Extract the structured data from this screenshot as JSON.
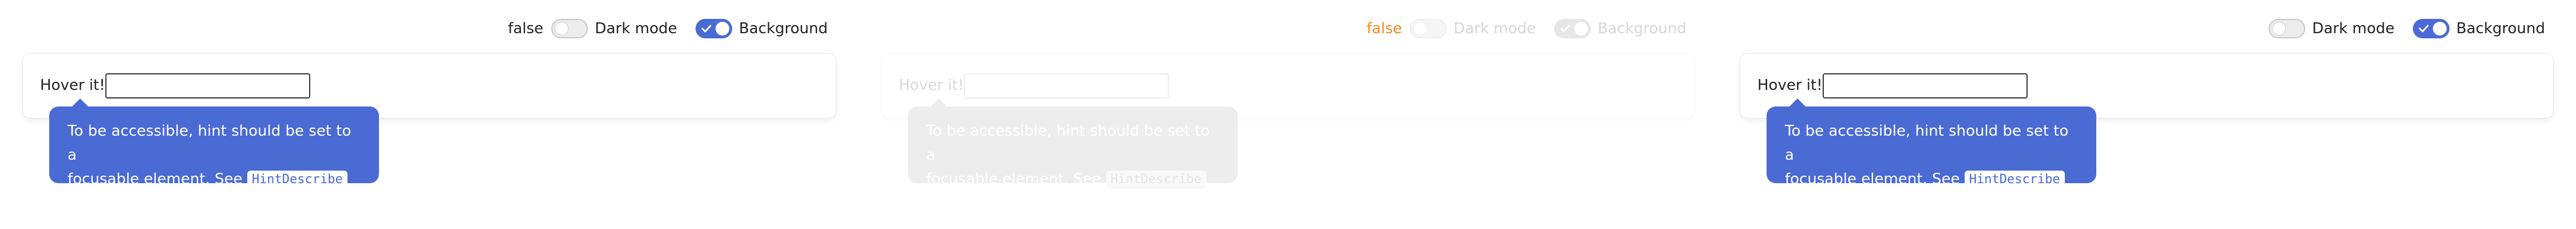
{
  "panels": [
    {
      "controls": {
        "bool_text": "false",
        "dark_mode_label": "Dark mode",
        "background_label": "Background",
        "dark_mode_on": false,
        "background_on": true
      },
      "hover_label": "Hover it!",
      "input_value": "",
      "tooltip": {
        "text_1": "To be accessible, hint should be set to a",
        "text_2": "focusable element. See",
        "code": "HintDescribe"
      }
    },
    {
      "controls": {
        "bool_text": "false",
        "dark_mode_label": "Dark mode",
        "background_label": "Background",
        "dark_mode_on": false,
        "background_on": true
      },
      "hover_label": "Hover it!",
      "input_value": "",
      "tooltip": {
        "text_1": "To be accessible, hint should be set to a",
        "text_2": "focusable element. See",
        "code": "HintDescribe"
      }
    },
    {
      "controls": {
        "bool_text": "",
        "dark_mode_label": "Dark mode",
        "background_label": "Background",
        "dark_mode_on": false,
        "background_on": true
      },
      "hover_label": "Hover it!",
      "input_value": "",
      "tooltip": {
        "text_1": "To be accessible, hint should be set to a",
        "text_2": "focusable element. See",
        "code": "HintDescribe"
      }
    }
  ],
  "colors": {
    "accent": "#4a6ad4",
    "false_text_faded": "#f08b1b"
  }
}
